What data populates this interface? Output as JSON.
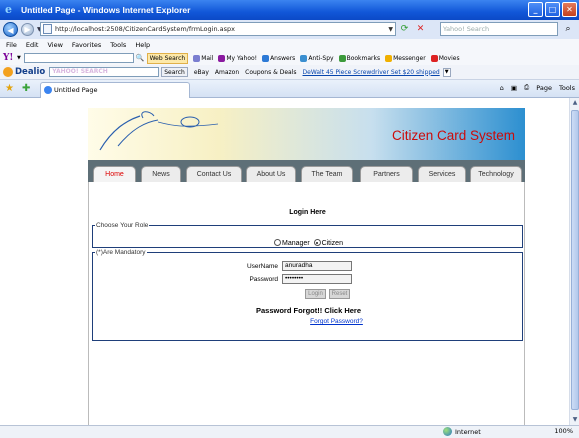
{
  "window": {
    "title": "Untitled Page - Windows Internet Explorer",
    "buttons": [
      "_",
      "□",
      "✕"
    ]
  },
  "address_bar": {
    "url": "http://localhost:2508/CitizenCardSystem/frmLogin.aspx",
    "search_placeholder": "Yahoo! Search"
  },
  "menu": [
    "File",
    "Edit",
    "View",
    "Favorites",
    "Tools",
    "Help"
  ],
  "yahoo_toolbar": {
    "logo": "Y!",
    "web_search": "Web Search",
    "items": [
      "Mail",
      "My Yahoo!",
      "Answers",
      "Anti-Spy",
      "Bookmarks",
      "Messenger",
      "Movies"
    ]
  },
  "dealio_toolbar": {
    "logo": "Dealio",
    "search_placeholder": "YAHOO! SEARCH",
    "search_button": "Search",
    "items": [
      "eBay",
      "Amazon",
      "Coupons & Deals"
    ],
    "promo_link": "DeWalt 45 Piece Screwdriver Set $20 shipped"
  },
  "tab": {
    "title": "Untitled Page"
  },
  "command_bar": {
    "page": "Page",
    "tools": "Tools"
  },
  "site": {
    "brand": "Citizen Card System",
    "nav": [
      "Home",
      "News",
      "Contact Us",
      "About Us",
      "The Team",
      "Partners",
      "Services",
      "Technology"
    ],
    "login_title": "Login Here",
    "role_legend": "Choose Your Role",
    "role_manager": "Manager",
    "role_citizen": "Citizen",
    "mandatory_legend": "(*)Are Mandatory",
    "username_label": "UserName",
    "username_value": "anuradha",
    "password_label": "Password",
    "password_value": "••••••••",
    "login_button": "Login",
    "reset_button": "Reset",
    "forgot_title": "Password Forgot!! Click Here",
    "forgot_link": "Forgot Password?"
  },
  "status_bar": {
    "zone": "Internet",
    "zoom": "100%"
  }
}
